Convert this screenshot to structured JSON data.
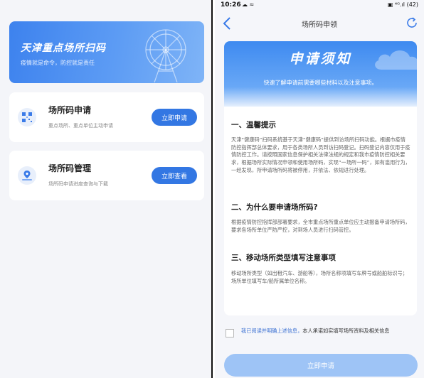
{
  "left": {
    "banner": {
      "title": "天津重点场所扫码",
      "subtitle": "疫情就是命令，防控就是责任"
    },
    "cards": [
      {
        "title": "场所码申请",
        "subtitle": "重点场所、重点单位主动申请",
        "button": "立即申请",
        "icon": "qr-code-icon"
      },
      {
        "title": "场所码管理",
        "subtitle": "场所码申请进度查询与下载",
        "button": "立即查看",
        "icon": "location-pin-icon"
      }
    ]
  },
  "right": {
    "status": {
      "time": "10:26",
      "left_icons": "☁ ≈",
      "right_icons": "▣ ⁴ᴳ.ıl (42)"
    },
    "nav": {
      "title": "场所码申领",
      "back_icon": "chevron-left-icon",
      "refresh_icon": "refresh-icon"
    },
    "notice": {
      "heading": "申请须知",
      "intro": "快速了解申请前需要哪些材料以及注意事项。",
      "sections": [
        {
          "title": "一、温馨提示",
          "body": "天津“健康码”扫码系统基于天津“健康码”提供到访场所扫码功能。根据市疫情防控指挥部总体要求，用于各类场所人员到访扫码登记。扫码登记内容仅用于疫情防控工作。请按照国家信息保护相关法律法规的规定和我市疫情防控相关要求，根据场所实际情况申领和使用场所码，实现“一场所一码”，如有滥用行为，一经发现，所申请场所码将被停用，并依法、依规进行处理。"
        },
        {
          "title": "二、为什么要申请场所码?",
          "body": "根据疫情防控指挥部部署要求，全市重点场所重点单位应主动报备申请场所码，要求各场所单位严防严控，对到场人员进行扫码管控。"
        },
        {
          "title": "三、移动场所类型填写注意事项",
          "body": "移动场所类型（如出租汽车、游船等），场所名称项填写车牌号或船舶标识号；场所单位填写车/船所属单位名称。"
        }
      ]
    },
    "agreement": {
      "part1": "我已阅读并明确上述信息，",
      "part2": "本人承诺如实填写场所资料及相关信息"
    },
    "submit_label": "立即申请"
  },
  "colors": {
    "primary": "#3377e3",
    "primary_disabled": "#9ec4f6",
    "banner_gradient_start": "#3d82ee",
    "page_bg": "#f4f5f9"
  }
}
